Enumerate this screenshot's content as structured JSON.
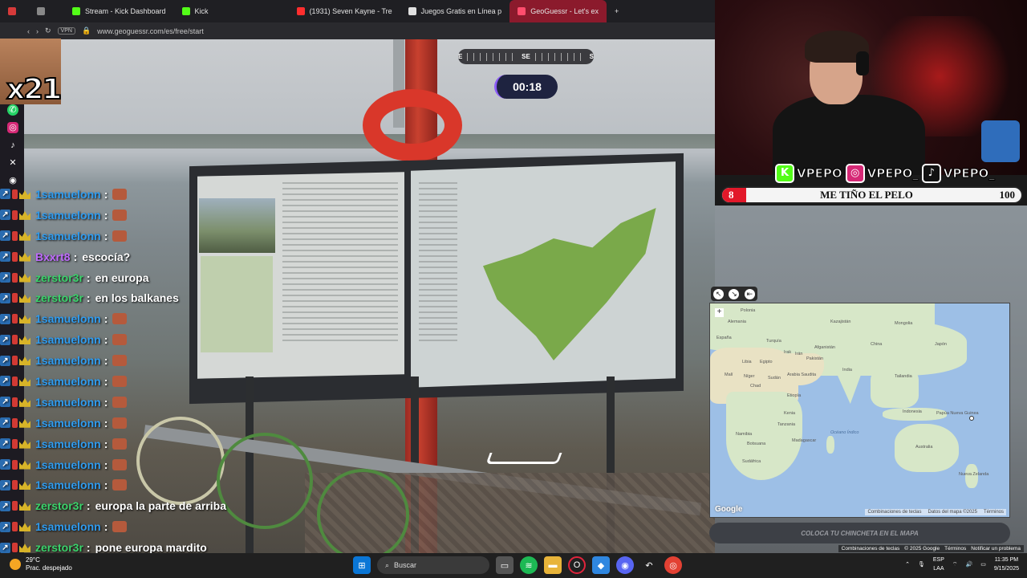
{
  "browser": {
    "tabs": [
      {
        "label": "",
        "color": "#d63a3a",
        "icon": "opera-icon"
      },
      {
        "label": "",
        "color": "#888888",
        "icon": "workspaces-icon"
      },
      {
        "label": "Stream - Kick Dashboard",
        "color": "#53fc18",
        "icon": "kick-icon"
      },
      {
        "label": "Kick",
        "color": "#53fc18",
        "icon": "kick-icon"
      },
      {
        "label": "(1931) Seven Kayne - Tre",
        "color": "#ff2e2e",
        "icon": "youtube-icon"
      },
      {
        "label": "Juegos Gratis en Línea p",
        "color": "#e0e0e0",
        "icon": "page-icon"
      },
      {
        "label": "GeoGuessr - Let's ex",
        "color": "#ff4d6d",
        "icon": "geoguessr-icon",
        "active": true
      }
    ],
    "vpn_label": "VPN",
    "url": "www.geoguessr.com/es/free/start"
  },
  "geoguessr": {
    "compass": {
      "left": "E",
      "center": "SE",
      "right": "S"
    },
    "timer": "00:18",
    "guess_button": "COLOCA TU CHINCHETA EN EL MAPA",
    "bottom_links": [
      "Combinaciones de teclas",
      "© 2025 Google",
      "Términos",
      "Notificar un problema"
    ]
  },
  "overlay": {
    "multiplier": "x21",
    "social_icons": [
      "whatsapp-icon",
      "instagram-icon",
      "tiktok-icon",
      "x-icon",
      "discord-icon"
    ]
  },
  "chat": [
    {
      "user": "1samuelonn",
      "color": "#2f9cf0",
      "msg": "",
      "emote": true
    },
    {
      "user": "1samuelonn",
      "color": "#2f9cf0",
      "msg": "",
      "emote": true
    },
    {
      "user": "1samuelonn",
      "color": "#2f9cf0",
      "msg": "",
      "emote": true
    },
    {
      "user": "Bxxrt8",
      "color": "#c06bff",
      "msg": "escocía?",
      "emote": false
    },
    {
      "user": "zerstor3r",
      "color": "#3ad36b",
      "msg": "en europa",
      "emote": false
    },
    {
      "user": "zerstor3r",
      "color": "#3ad36b",
      "msg": "en los balkanes",
      "emote": false
    },
    {
      "user": "1samuelonn",
      "color": "#2f9cf0",
      "msg": "",
      "emote": true
    },
    {
      "user": "1samuelonn",
      "color": "#2f9cf0",
      "msg": "",
      "emote": true
    },
    {
      "user": "1samuelonn",
      "color": "#2f9cf0",
      "msg": "",
      "emote": true
    },
    {
      "user": "1samuelonn",
      "color": "#2f9cf0",
      "msg": "",
      "emote": true
    },
    {
      "user": "1samuelonn",
      "color": "#2f9cf0",
      "msg": "",
      "emote": true
    },
    {
      "user": "1samuelonn",
      "color": "#2f9cf0",
      "msg": "",
      "emote": true
    },
    {
      "user": "1samuelonn",
      "color": "#2f9cf0",
      "msg": "",
      "emote": true
    },
    {
      "user": "1samuelonn",
      "color": "#2f9cf0",
      "msg": "",
      "emote": true
    },
    {
      "user": "1samuelonn",
      "color": "#2f9cf0",
      "msg": "",
      "emote": true
    },
    {
      "user": "zerstor3r",
      "color": "#3ad36b",
      "msg": "europa la parte de arriba",
      "emote": false
    },
    {
      "user": "1samuelonn",
      "color": "#2f9cf0",
      "msg": "",
      "emote": true
    },
    {
      "user": "zerstor3r",
      "color": "#3ad36b",
      "msg": "pone europa mardito",
      "emote": false
    }
  ],
  "stream": {
    "socials": [
      {
        "icon": "kick-icon",
        "handle": "VPEPO",
        "color": "#53fc18"
      },
      {
        "icon": "instagram-icon",
        "handle": "VPEPO_",
        "color": "#d62976"
      },
      {
        "icon": "tiktok-icon",
        "handle": "VPEPO_",
        "color": "#111111"
      }
    ],
    "goal": {
      "current": "8",
      "label": "ME TIÑO EL PELO",
      "target": "100",
      "fraction": 0.08
    }
  },
  "map": {
    "labels": [
      {
        "t": "Polonia"
      },
      {
        "t": "Kazajistán"
      },
      {
        "t": "Mongolia"
      },
      {
        "t": "Alemania"
      },
      {
        "t": "España"
      },
      {
        "t": "Turquía"
      },
      {
        "t": "Irak"
      },
      {
        "t": "Irán"
      },
      {
        "t": "Afganistán"
      },
      {
        "t": "China"
      },
      {
        "t": "Pakistán"
      },
      {
        "t": "Japón"
      },
      {
        "t": "Libia"
      },
      {
        "t": "Egipto"
      },
      {
        "t": "Arabia Saudita"
      },
      {
        "t": "India"
      },
      {
        "t": "Tailandia"
      },
      {
        "t": "Malí"
      },
      {
        "t": "Níger"
      },
      {
        "t": "Sudán"
      },
      {
        "t": "Chad"
      },
      {
        "t": "Etiopía"
      },
      {
        "t": "Kenia"
      },
      {
        "t": "Tanzania"
      },
      {
        "t": "Indonesia"
      },
      {
        "t": "Papúa Nueva Guinea"
      },
      {
        "t": "Namibia"
      },
      {
        "t": "Botsuana"
      },
      {
        "t": "Sudáfrica"
      },
      {
        "t": "Madagascar"
      },
      {
        "t": "Australia"
      },
      {
        "t": "Nueva Zelanda"
      },
      {
        "t": "Océano Índico",
        "ocean": true
      }
    ],
    "google_label": "Google",
    "footer": [
      "Combinaciones de teclas",
      "Datos del mapa ©2025",
      "Términos"
    ]
  },
  "taskbar": {
    "weather_temp": "29°C",
    "weather_desc": "Prac. despejado",
    "search_label": "Buscar",
    "lang": "ESP",
    "lang2": "LAA",
    "time": "11:35 PM",
    "date": "9/15/2025",
    "apps": [
      "windows-icon",
      "search-icon",
      "file-explorer-icon",
      "spotify-icon",
      "folder-icon",
      "opera-icon",
      "app-icon",
      "discord-icon",
      "kick-studio-icon",
      "chrome-icon"
    ]
  }
}
